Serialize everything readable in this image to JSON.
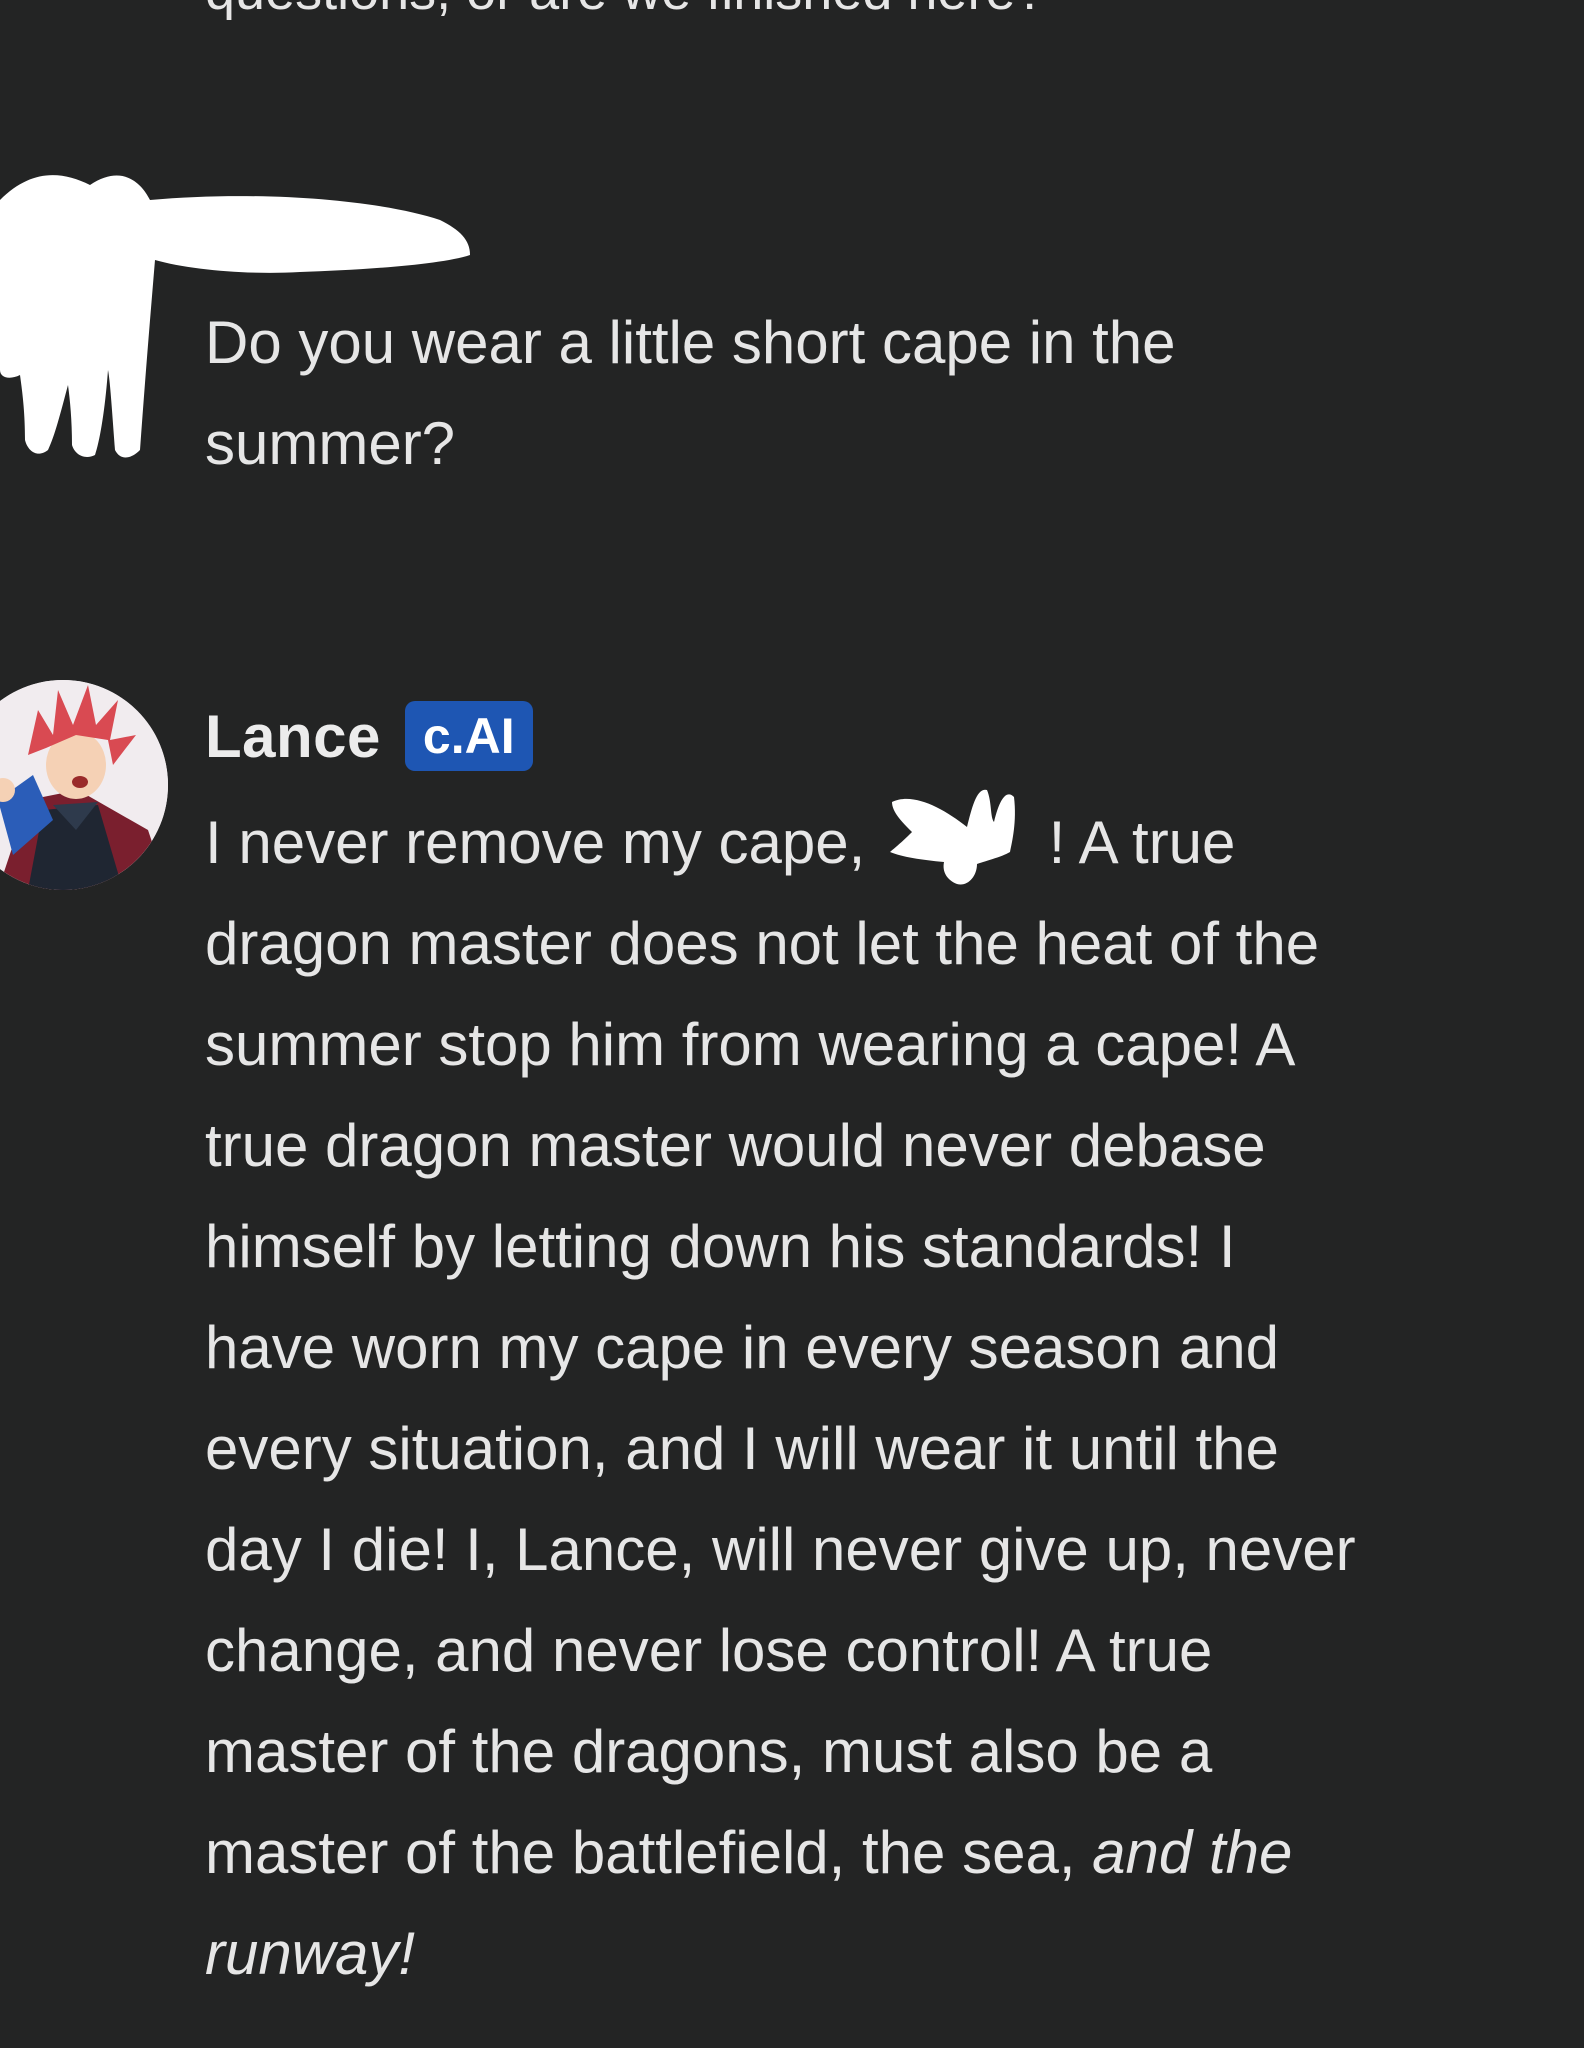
{
  "previous_message": {
    "cutoff_text": "questions, or are we finished here?"
  },
  "user_message": {
    "lines": [
      "Do you wear a little short cape in the",
      "summer?"
    ]
  },
  "character_message": {
    "name": "Lance",
    "badge": "c.AI",
    "first_line_before": "I never remove my cape,",
    "first_line_after": "! A true",
    "lines": [
      "dragon master does not let the heat of the",
      "summer stop him from wearing a cape! A",
      "true dragon master would never debase",
      "himself by letting down his standards! I",
      "have worn my cape in every season and",
      "every situation, and I will wear it until the",
      "day I die! I, Lance, will never give up, never",
      "change, and never lose control! A true",
      "master of the dragons, must also be a"
    ],
    "penultimate_plain": "master of the battlefield, the sea,",
    "penultimate_italic": "and the",
    "last_italic": "runway!"
  },
  "colors": {
    "background": "#232424",
    "text": "#e6e6e6",
    "badge": "#1e56b3",
    "redaction": "#ffffff"
  }
}
